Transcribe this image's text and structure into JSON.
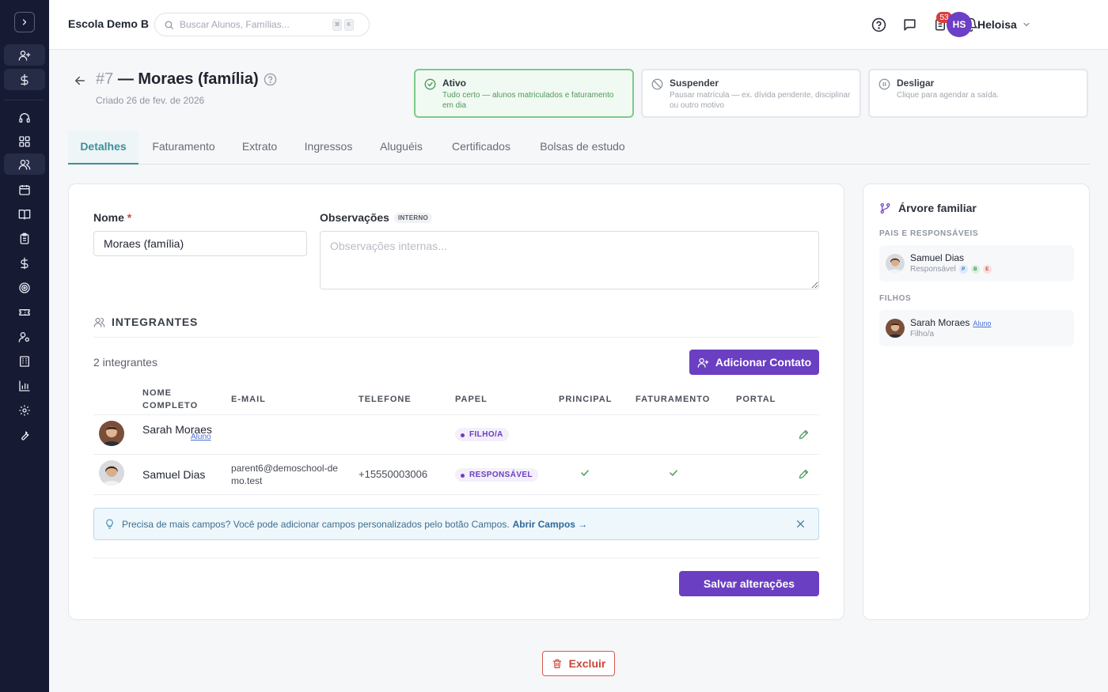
{
  "topbar": {
    "school_name": "Escola Demo B",
    "search_placeholder": "Buscar Alunos, Famílias...",
    "shortcut_keys": [
      "⌘",
      "K"
    ],
    "notification_count": "53",
    "user_initials": "HS",
    "user_name": "Heloisa"
  },
  "header": {
    "record_number": "#7",
    "title": "— Moraes (família)",
    "created": "Criado 26 de fev. de 2026"
  },
  "status_cards": [
    {
      "title": "Ativo",
      "description": "Tudo certo — alunos matriculados e faturamento em dia",
      "active": true
    },
    {
      "title": "Suspender",
      "description": "Pausar matrícula — ex. dívida pendente, disciplinar ou outro motivo",
      "active": false
    },
    {
      "title": "Desligar",
      "description": "Clique para agendar a saída.",
      "active": false
    }
  ],
  "tabs": [
    "Detalhes",
    "Faturamento",
    "Extrato",
    "Ingressos",
    "Aluguéis",
    "Certificados",
    "Bolsas de estudo"
  ],
  "form": {
    "name_label": "Nome",
    "required_mark": "*",
    "name_value": "Moraes (família)",
    "notes_label": "Observações",
    "notes_tag": "INTERNO",
    "notes_placeholder": "Observações internas..."
  },
  "members": {
    "section_title": "INTEGRANTES",
    "count_text": "2 integrantes",
    "add_button": "Adicionar Contato",
    "columns": [
      "NOME COMPLETO",
      "E-MAIL",
      "TELEFONE",
      "PAPEL",
      "PRINCIPAL",
      "FATURAMENTO",
      "PORTAL"
    ],
    "rows": [
      {
        "name": "Sarah Moraes",
        "tag": "Aluno",
        "email": "",
        "phone": "",
        "role": "FILHO/A",
        "principal": false,
        "billing": false
      },
      {
        "name": "Samuel Dias",
        "tag": "",
        "email": "parent6@demoschool-demo.test",
        "phone": "+15550003006",
        "role": "RESPONSÁVEL",
        "principal": true,
        "billing": true
      }
    ]
  },
  "tip": {
    "text": "Precisa de mais campos? Você pode adicionar campos personalizados pelo botão Campos.",
    "link": "Abrir Campos →"
  },
  "save_button": "Salvar alterações",
  "delete_button": "Excluir",
  "family_tree": {
    "title": "Árvore familiar",
    "parents_label": "PAIS E RESPONSÁVEIS",
    "parent": {
      "name": "Samuel Dias",
      "role": "Responsável",
      "badges": [
        "P",
        "B",
        "E"
      ]
    },
    "children_label": "FILHOS",
    "child": {
      "name": "Sarah Moraes",
      "tag": "Aluno",
      "role": "Filho/a"
    }
  },
  "colors": {
    "primary": "#6a3fc2",
    "accent_tab": "#3d8f9a",
    "sidebar": "#161a33",
    "success_border": "#7ec98a",
    "danger": "#c8443b"
  }
}
